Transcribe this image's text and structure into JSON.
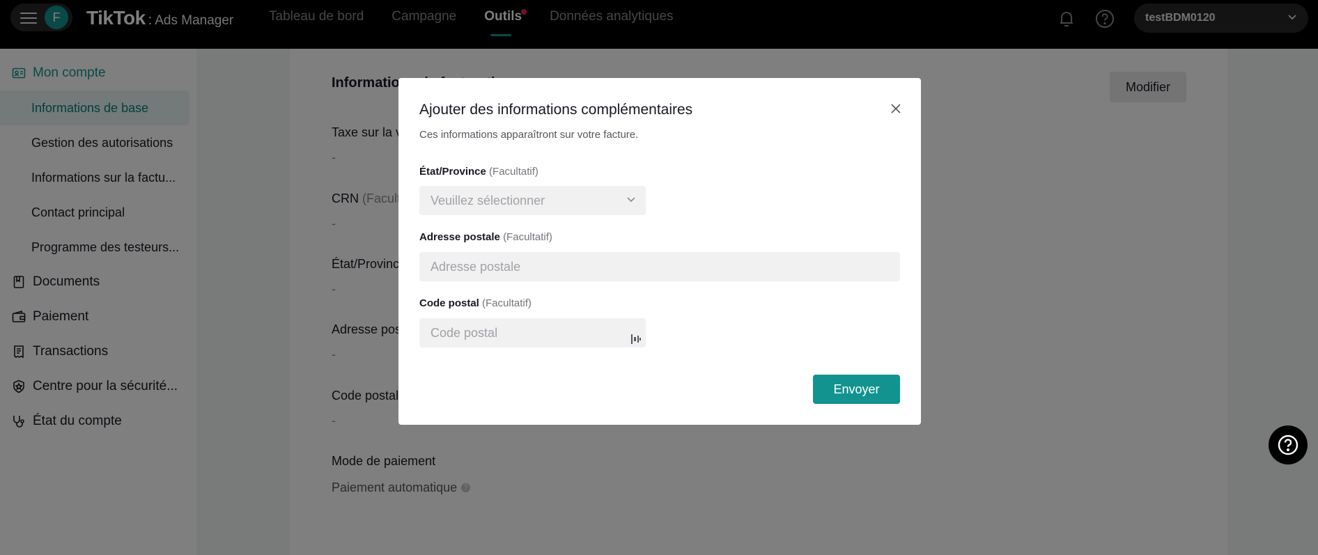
{
  "header": {
    "avatar_letter": "F",
    "brand": "TikTok",
    "brand_sep": ":",
    "brand_sub": "Ads Manager",
    "nav": [
      {
        "label": "Tableau de bord"
      },
      {
        "label": "Campagne"
      },
      {
        "label": "Outils"
      },
      {
        "label": "Données analytiques"
      }
    ],
    "account_name": "testBDM0120"
  },
  "sidebar": {
    "my_account": "Mon compte",
    "items": [
      {
        "label": "Informations de base"
      },
      {
        "label": "Gestion des autorisations"
      },
      {
        "label": "Informations sur la factu..."
      },
      {
        "label": "Contact principal"
      },
      {
        "label": "Programme des testeurs..."
      }
    ],
    "groups": [
      {
        "label": "Documents"
      },
      {
        "label": "Paiement"
      },
      {
        "label": "Transactions"
      },
      {
        "label": "Centre pour la sécurité..."
      },
      {
        "label": "État du compte"
      }
    ]
  },
  "main": {
    "card_title": "Informations de facturation",
    "modify_label": "Modifier",
    "fields": [
      {
        "label": "Taxe sur la valeur ajoutée",
        "value": "-"
      },
      {
        "label": "CRN",
        "optional": "(Facultatif)",
        "value": "-"
      },
      {
        "label": "État/Province",
        "value": "-"
      },
      {
        "label": "Adresse postale",
        "value": "-"
      },
      {
        "label": "Code postal",
        "value": "-"
      }
    ],
    "payment_label": "Mode de paiement",
    "payment_value": "Paiement automatique",
    "info_glyph": "?"
  },
  "modal": {
    "title": "Ajouter des informations complémentaires",
    "subtitle": "Ces informations apparaîtront sur votre facture.",
    "optional_tag": "(Facultatif)",
    "state_label": "État/Province",
    "state_placeholder": "Veuillez sélectionner",
    "address_label": "Adresse postale",
    "address_placeholder": "Adresse postale",
    "address_value": "",
    "zip_label": "Code postal",
    "zip_placeholder": "Code postal",
    "zip_value": "",
    "submit_label": "Envoyer"
  },
  "colors": {
    "accent": "#12938f",
    "notification_dot": "#ee1d52",
    "topbar": "#000000"
  }
}
